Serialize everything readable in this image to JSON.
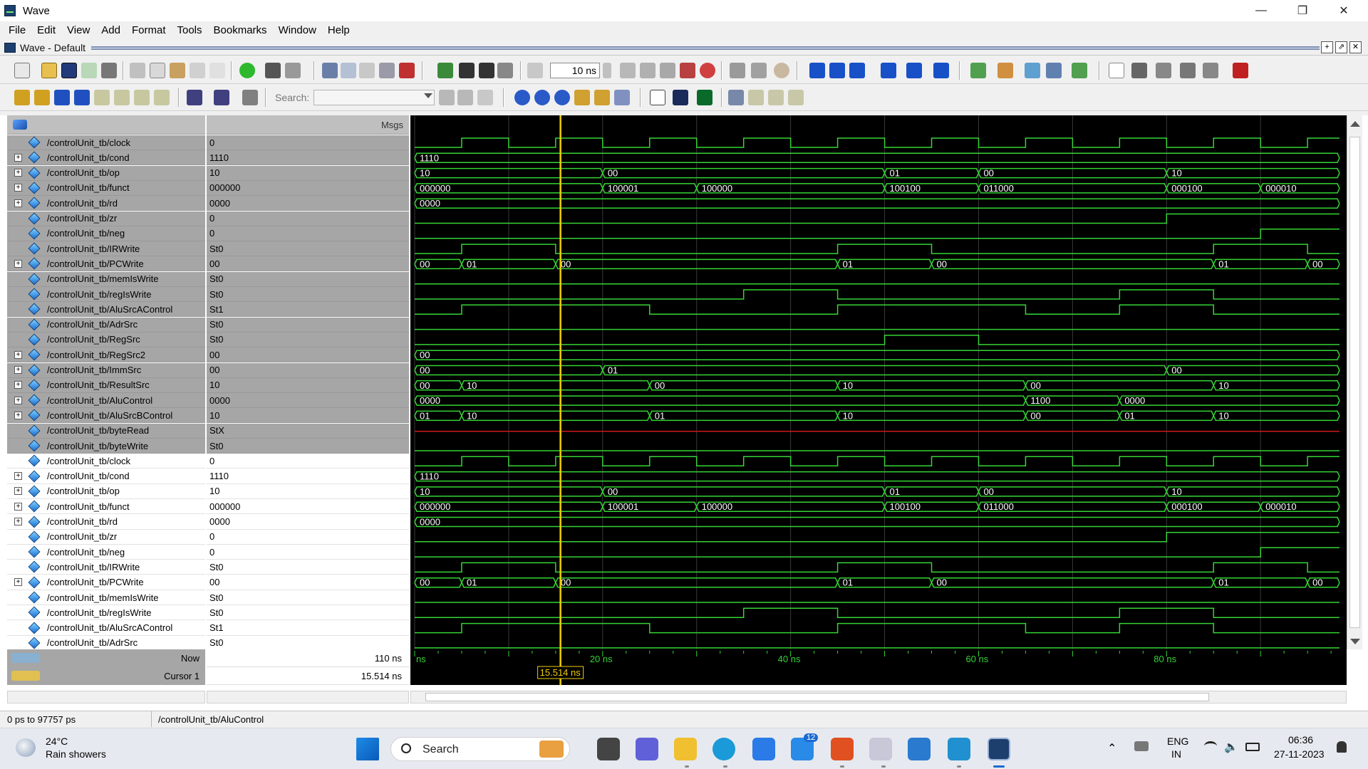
{
  "window": {
    "title": "Wave",
    "controls": {
      "minimize": "—",
      "maximize": "❐",
      "close": "✕"
    }
  },
  "menu": {
    "items": [
      {
        "label": "File"
      },
      {
        "label": "Edit"
      },
      {
        "label": "View"
      },
      {
        "label": "Add"
      },
      {
        "label": "Format"
      },
      {
        "label": "Tools"
      },
      {
        "label": "Bookmarks"
      },
      {
        "label": "Window"
      },
      {
        "label": "Help"
      }
    ]
  },
  "pane": {
    "title": "Wave - Default"
  },
  "toolbar": {
    "time_step_value": "10",
    "time_step_unit": "ns",
    "search_label": "Search:",
    "search_value": ""
  },
  "wave": {
    "header_msgs": "Msgs",
    "signals": [
      {
        "name": "/controlUnit_tb/clock",
        "value": "0",
        "bus": false,
        "selected": true
      },
      {
        "name": "/controlUnit_tb/cond",
        "value": "1110",
        "bus": true,
        "selected": true
      },
      {
        "name": "/controlUnit_tb/op",
        "value": "10",
        "bus": true,
        "selected": true
      },
      {
        "name": "/controlUnit_tb/funct",
        "value": "000000",
        "bus": true,
        "selected": true
      },
      {
        "name": "/controlUnit_tb/rd",
        "value": "0000",
        "bus": true,
        "selected": true
      },
      {
        "name": "/controlUnit_tb/zr",
        "value": "0",
        "bus": false,
        "selected": true
      },
      {
        "name": "/controlUnit_tb/neg",
        "value": "0",
        "bus": false,
        "selected": true
      },
      {
        "name": "/controlUnit_tb/IRWrite",
        "value": "St0",
        "bus": false,
        "selected": true
      },
      {
        "name": "/controlUnit_tb/PCWrite",
        "value": "00",
        "bus": true,
        "selected": true
      },
      {
        "name": "/controlUnit_tb/memIsWrite",
        "value": "St0",
        "bus": false,
        "selected": true
      },
      {
        "name": "/controlUnit_tb/regIsWrite",
        "value": "St0",
        "bus": false,
        "selected": true
      },
      {
        "name": "/controlUnit_tb/AluSrcAControl",
        "value": "St1",
        "bus": false,
        "selected": true
      },
      {
        "name": "/controlUnit_tb/AdrSrc",
        "value": "St0",
        "bus": false,
        "selected": true
      },
      {
        "name": "/controlUnit_tb/RegSrc",
        "value": "St0",
        "bus": false,
        "selected": true
      },
      {
        "name": "/controlUnit_tb/RegSrc2",
        "value": "00",
        "bus": true,
        "selected": true
      },
      {
        "name": "/controlUnit_tb/ImmSrc",
        "value": "00",
        "bus": true,
        "selected": true
      },
      {
        "name": "/controlUnit_tb/ResultSrc",
        "value": "10",
        "bus": true,
        "selected": true
      },
      {
        "name": "/controlUnit_tb/AluControl",
        "value": "0000",
        "bus": true,
        "selected": true
      },
      {
        "name": "/controlUnit_tb/AluSrcBControl",
        "value": "10",
        "bus": true,
        "selected": true
      },
      {
        "name": "/controlUnit_tb/byteRead",
        "value": "StX",
        "bus": false,
        "selected": true
      },
      {
        "name": "/controlUnit_tb/byteWrite",
        "value": "St0",
        "bus": false,
        "selected": true
      },
      {
        "name": "/controlUnit_tb/clock",
        "value": "0",
        "bus": false,
        "selected": false
      },
      {
        "name": "/controlUnit_tb/cond",
        "value": "1110",
        "bus": true,
        "selected": false
      },
      {
        "name": "/controlUnit_tb/op",
        "value": "10",
        "bus": true,
        "selected": false
      },
      {
        "name": "/controlUnit_tb/funct",
        "value": "000000",
        "bus": true,
        "selected": false
      },
      {
        "name": "/controlUnit_tb/rd",
        "value": "0000",
        "bus": true,
        "selected": false
      },
      {
        "name": "/controlUnit_tb/zr",
        "value": "0",
        "bus": false,
        "selected": false
      },
      {
        "name": "/controlUnit_tb/neg",
        "value": "0",
        "bus": false,
        "selected": false
      },
      {
        "name": "/controlUnit_tb/IRWrite",
        "value": "St0",
        "bus": false,
        "selected": false
      },
      {
        "name": "/controlUnit_tb/PCWrite",
        "value": "00",
        "bus": true,
        "selected": false
      },
      {
        "name": "/controlUnit_tb/memIsWrite",
        "value": "St0",
        "bus": false,
        "selected": false
      },
      {
        "name": "/controlUnit_tb/regIsWrite",
        "value": "St0",
        "bus": false,
        "selected": false
      },
      {
        "name": "/controlUnit_tb/AluSrcAControl",
        "value": "St1",
        "bus": false,
        "selected": false
      },
      {
        "name": "/controlUnit_tb/AdrSrc",
        "value": "St0",
        "bus": false,
        "selected": false
      }
    ],
    "traces": {
      "clock": {
        "type": "clock",
        "period_ns": 10,
        "start_high": false
      },
      "cond": {
        "type": "bus",
        "segments": [
          [
            0,
            "1110"
          ]
        ]
      },
      "op": {
        "type": "bus",
        "segments": [
          [
            0,
            "10"
          ],
          [
            20,
            "00"
          ],
          [
            50,
            "01"
          ],
          [
            60,
            "00"
          ],
          [
            80,
            "10"
          ]
        ]
      },
      "funct": {
        "type": "bus",
        "segments": [
          [
            0,
            "000000"
          ],
          [
            20,
            "100001"
          ],
          [
            30,
            "100000"
          ],
          [
            50,
            "100100"
          ],
          [
            60,
            "011000"
          ],
          [
            80,
            "000100"
          ],
          [
            90,
            "000010"
          ]
        ]
      },
      "rd": {
        "type": "bus",
        "segments": [
          [
            0,
            "0000"
          ]
        ]
      },
      "zr": {
        "type": "bit",
        "changes": [
          [
            0,
            0
          ],
          [
            80,
            1
          ]
        ]
      },
      "neg": {
        "type": "bit",
        "changes": [
          [
            0,
            0
          ],
          [
            90,
            1
          ]
        ]
      },
      "IRWrite": {
        "type": "bit",
        "changes": [
          [
            0,
            0
          ],
          [
            5,
            1
          ],
          [
            15,
            0
          ],
          [
            45,
            1
          ],
          [
            55,
            0
          ],
          [
            85,
            1
          ],
          [
            95,
            0
          ]
        ]
      },
      "PCWrite": {
        "type": "bus",
        "segments": [
          [
            0,
            "00"
          ],
          [
            5,
            "01"
          ],
          [
            15,
            "00"
          ],
          [
            45,
            "01"
          ],
          [
            55,
            "00"
          ],
          [
            85,
            "01"
          ],
          [
            95,
            "00"
          ]
        ]
      },
      "memIsWrite": {
        "type": "bit",
        "changes": [
          [
            0,
            0
          ]
        ]
      },
      "regIsWrite": {
        "type": "bit",
        "changes": [
          [
            0,
            0
          ],
          [
            35,
            1
          ],
          [
            45,
            0
          ],
          [
            75,
            1
          ],
          [
            85,
            0
          ]
        ]
      },
      "AluSrcAControl": {
        "type": "bit",
        "changes": [
          [
            0,
            0
          ],
          [
            5,
            1
          ],
          [
            25,
            0
          ],
          [
            45,
            1
          ],
          [
            65,
            0
          ],
          [
            75,
            1
          ],
          [
            85,
            0
          ]
        ]
      },
      "AdrSrc": {
        "type": "bit",
        "changes": [
          [
            0,
            0
          ]
        ]
      },
      "RegSrc": {
        "type": "bit",
        "changes": [
          [
            0,
            0
          ],
          [
            50,
            1
          ],
          [
            60,
            0
          ]
        ]
      },
      "RegSrc2": {
        "type": "bus",
        "segments": [
          [
            0,
            "00"
          ]
        ]
      },
      "ImmSrc": {
        "type": "bus",
        "segments": [
          [
            0,
            "00"
          ],
          [
            20,
            "01"
          ],
          [
            80,
            "00"
          ]
        ]
      },
      "ResultSrc": {
        "type": "bus",
        "segments": [
          [
            0,
            "00"
          ],
          [
            5,
            "10"
          ],
          [
            25,
            "00"
          ],
          [
            45,
            "10"
          ],
          [
            65,
            "00"
          ],
          [
            85,
            "10"
          ]
        ]
      },
      "AluControl": {
        "type": "bus",
        "segments": [
          [
            0,
            "0000"
          ],
          [
            65,
            "1100"
          ],
          [
            75,
            "0000"
          ]
        ]
      },
      "AluSrcBControl": {
        "type": "bus",
        "segments": [
          [
            0,
            "01"
          ],
          [
            5,
            "10"
          ],
          [
            25,
            "01"
          ],
          [
            45,
            "10"
          ],
          [
            65,
            "00"
          ],
          [
            75,
            "01"
          ],
          [
            85,
            "10"
          ]
        ]
      },
      "byteRead": {
        "type": "x"
      },
      "byteWrite": {
        "type": "bit",
        "changes": [
          [
            0,
            0
          ]
        ]
      }
    },
    "view": {
      "start_ns": 0,
      "end_ns": 98.4
    },
    "axis": {
      "labels": [
        "ns",
        "20 ns",
        "40 ns",
        "60 ns",
        "80 ns"
      ],
      "label_values_ns": [
        0,
        20,
        40,
        60,
        80
      ]
    },
    "cursor": {
      "time_ns": 15.514,
      "label": "15.514 ns"
    }
  },
  "cursor_panel": {
    "now_label": "Now",
    "now_value": "110 ns",
    "cursor_label": "Cursor 1",
    "cursor_value": "15.514 ns"
  },
  "status": {
    "range": "0 ps to 97757 ps",
    "selected_signal": "/controlUnit_tb/AluControl"
  },
  "taskbar": {
    "weather_temp": "24°C",
    "weather_desc": "Rain showers",
    "search_label": "Search",
    "lang_top": "ENG",
    "lang_bottom": "IN",
    "time": "06:36",
    "date": "27-11-2023",
    "badge": "12"
  },
  "colors": {
    "wave_green": "#35d435",
    "cursor_yellow": "#f0d000",
    "x_red": "#d01818",
    "grid_gray": "#3a3a3a"
  }
}
